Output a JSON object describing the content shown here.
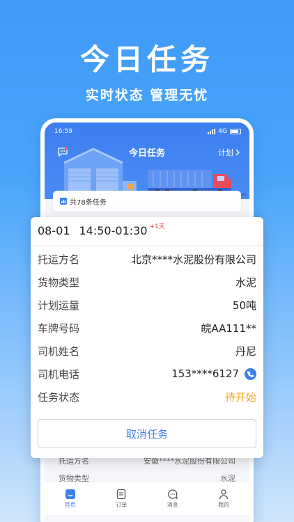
{
  "hero": {
    "title": "今日任务",
    "subtitle": "实时状态  管理无忧"
  },
  "status_bar": {
    "time": "16:59",
    "network": "4G"
  },
  "nav": {
    "title": "今日任务",
    "plan_label": "计划"
  },
  "task_count": {
    "label": "共78条任务"
  },
  "card": {
    "date": "08-01",
    "time_range": "14:50-01:30",
    "day_offset": "+1天",
    "rows": [
      {
        "label": "托运方名",
        "value": "北京****水泥股份有限公司"
      },
      {
        "label": "货物类型",
        "value": "水泥"
      },
      {
        "label": "计划运量",
        "value": "50吨"
      },
      {
        "label": "车牌号码",
        "value": "皖AA111**"
      },
      {
        "label": "司机姓名",
        "value": "丹尼"
      },
      {
        "label": "司机电话",
        "value": "153****6127"
      },
      {
        "label": "任务状态",
        "value": "待开始"
      }
    ],
    "cancel_label": "取消任务"
  },
  "background_list": [
    {
      "label": "托运方名",
      "value": "安徽****水泥股份有限公司"
    },
    {
      "label": "货物类型",
      "value": "水泥"
    }
  ],
  "tabs": [
    {
      "label": "首页",
      "icon": "home-icon",
      "active": true
    },
    {
      "label": "订单",
      "icon": "order-icon",
      "active": false
    },
    {
      "label": "消息",
      "icon": "message-icon",
      "active": false
    },
    {
      "label": "我的",
      "icon": "profile-icon",
      "active": false
    }
  ],
  "colors": {
    "primary": "#3d7ef0",
    "status_pending": "#f5a623",
    "day_offset": "#e53935"
  }
}
